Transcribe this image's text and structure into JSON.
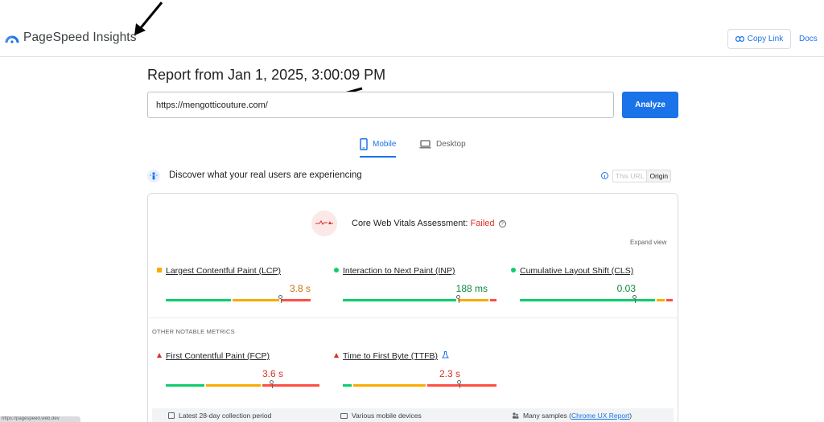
{
  "header": {
    "app_title": "PageSpeed Insights",
    "copy_link_label": "Copy Link",
    "docs_label": "Docs"
  },
  "report": {
    "title": "Report from Jan 1, 2025, 3:00:09 PM",
    "url_value": "https://mengotticouture.com/",
    "analyze_label": "Analyze"
  },
  "tabs": [
    {
      "label": "Mobile",
      "selected": true
    },
    {
      "label": "Desktop",
      "selected": false
    }
  ],
  "discover": {
    "text": "Discover what your real users are experiencing",
    "toggle_this_url": "This URL",
    "toggle_origin": "Origin"
  },
  "assessment": {
    "prefix": "Core Web Vitals Assessment: ",
    "status": "Failed",
    "expand_label": "Expand view"
  },
  "core_metrics": [
    {
      "label": "Largest Contentful Paint (LCP)",
      "value": "3.8 s",
      "status": "needs-improvement",
      "color": "#c5700a"
    },
    {
      "label": "Interaction to Next Paint (INP)",
      "value": "188 ms",
      "status": "good",
      "color": "#0d8a3e"
    },
    {
      "label": "Cumulative Layout Shift (CLS)",
      "value": "0.03",
      "status": "good",
      "color": "#0d8a3e"
    }
  ],
  "other_metrics_label": "OTHER NOTABLE METRICS",
  "other_metrics": [
    {
      "label": "First Contentful Paint (FCP)",
      "value": "3.6 s",
      "status": "poor",
      "color": "#d93025"
    },
    {
      "label": "Time to First Byte (TTFB)",
      "value": "2.3 s",
      "status": "poor",
      "color": "#d93025"
    }
  ],
  "footer": {
    "collection_period": "Latest 28-day collection period",
    "devices": "Various mobile devices",
    "samples_prefix": "Many samples (",
    "samples_link": "Chrome UX Report",
    "samples_suffix": ")"
  },
  "status_bar": "https://pagespeed.web.dev",
  "colors": {
    "accent": "#1a73e8",
    "good": "#0cce6b",
    "average": "#f9ab00",
    "poor": "#ff4e42"
  }
}
